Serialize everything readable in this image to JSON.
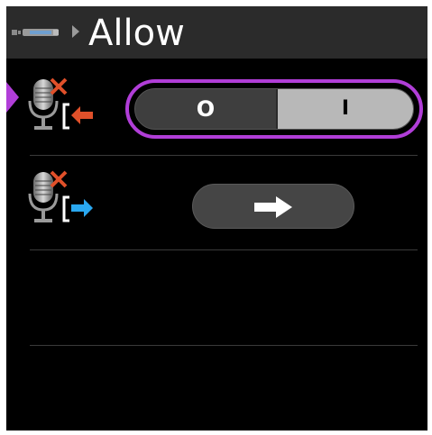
{
  "header": {
    "title": "Allow",
    "crumb_icon": "device-remote-icon",
    "crumb_separator_icon": "triangle-right-icon"
  },
  "rows": [
    {
      "icon": "microphone-muted-import-icon",
      "selected": true,
      "control": {
        "type": "toggle",
        "off_label": "O",
        "on_label": "I",
        "state": "on"
      }
    },
    {
      "icon": "microphone-muted-export-icon",
      "selected": false,
      "control": {
        "type": "button",
        "icon": "arrow-right-icon"
      }
    },
    {
      "icon": null,
      "selected": false,
      "control": null
    }
  ],
  "colors": {
    "focus_accent": "#b13ed8",
    "import_arrow": "#e0502a",
    "export_arrow": "#2aa8f0",
    "header_bg": "#2b2b2b",
    "background": "#000000"
  }
}
